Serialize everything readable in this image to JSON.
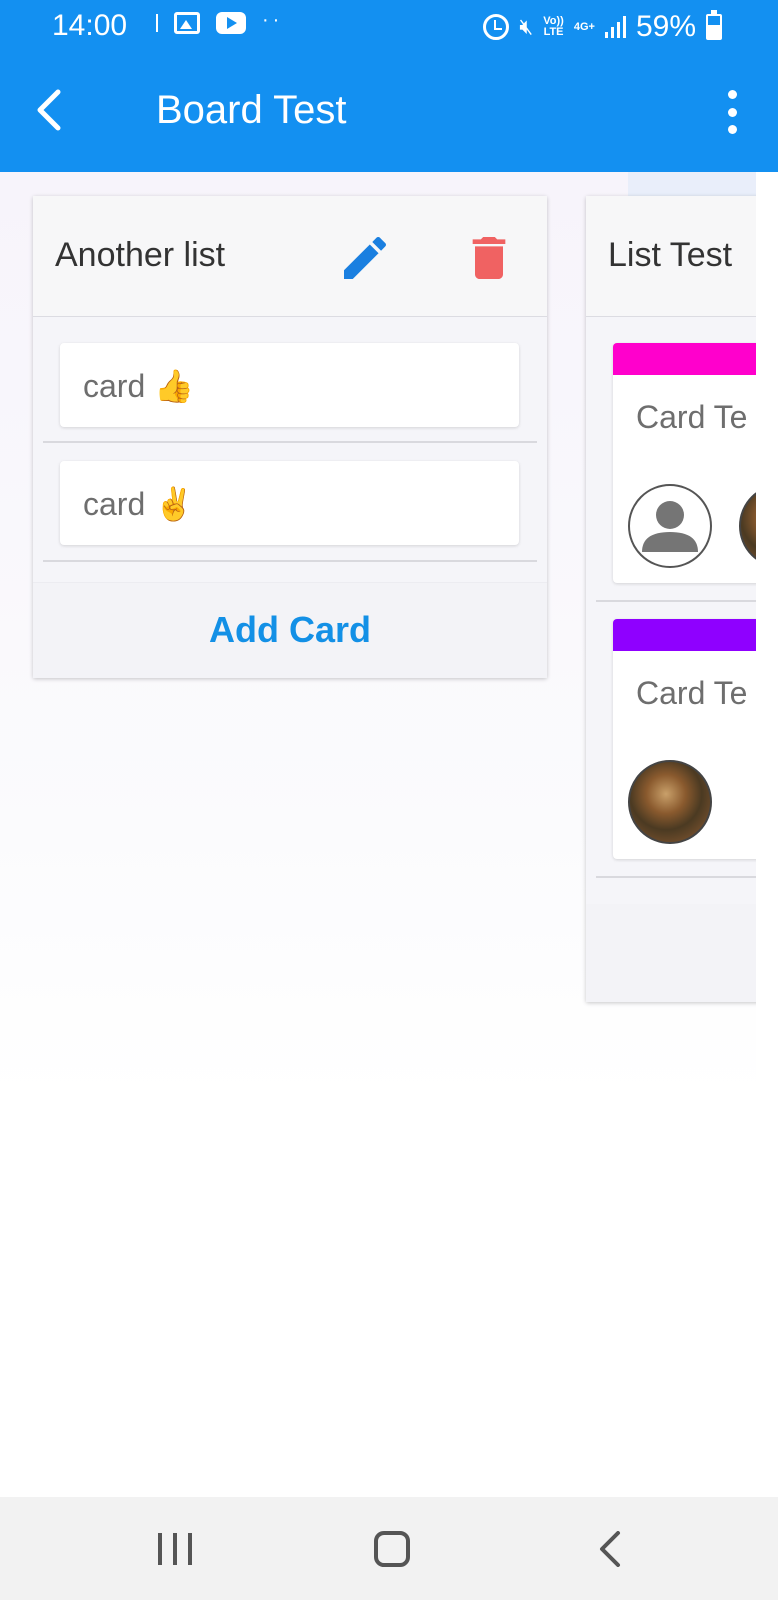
{
  "status_bar": {
    "time": "14:00",
    "volte": "Vo))\nLTE",
    "network": "4G+",
    "battery": "59%",
    "icons": [
      "gallery-icon",
      "youtube-icon",
      "more-dots-icon",
      "alarm-icon",
      "mute-icon",
      "volte-icon",
      "signal-icon",
      "battery-icon"
    ]
  },
  "app_bar": {
    "title": "Board Test",
    "back_icon": "chevron-left-icon",
    "menu_icon": "more-vertical-icon"
  },
  "lists": [
    {
      "title": "Another list",
      "edit_icon": "pencil-icon",
      "delete_icon": "trash-icon",
      "cards": [
        {
          "text": "card 👍"
        },
        {
          "text": "card ✌️"
        }
      ],
      "add_card_label": "Add Card"
    },
    {
      "title": "List Test",
      "cards": [
        {
          "text": "Card Te",
          "label_color": "#ff00cc",
          "avatars": [
            "default-user",
            "photo"
          ]
        },
        {
          "text": "Card Te",
          "label_color": "#8f00ff",
          "avatars": [
            "photo"
          ]
        }
      ]
    }
  ],
  "colors": {
    "primary": "#1390f1",
    "add_card_text": "#1390e6",
    "delete_icon": "#f06262",
    "edit_icon": "#1a7fe0"
  },
  "nav_bar": {
    "icons": [
      "recents-icon",
      "home-icon",
      "back-icon"
    ]
  }
}
